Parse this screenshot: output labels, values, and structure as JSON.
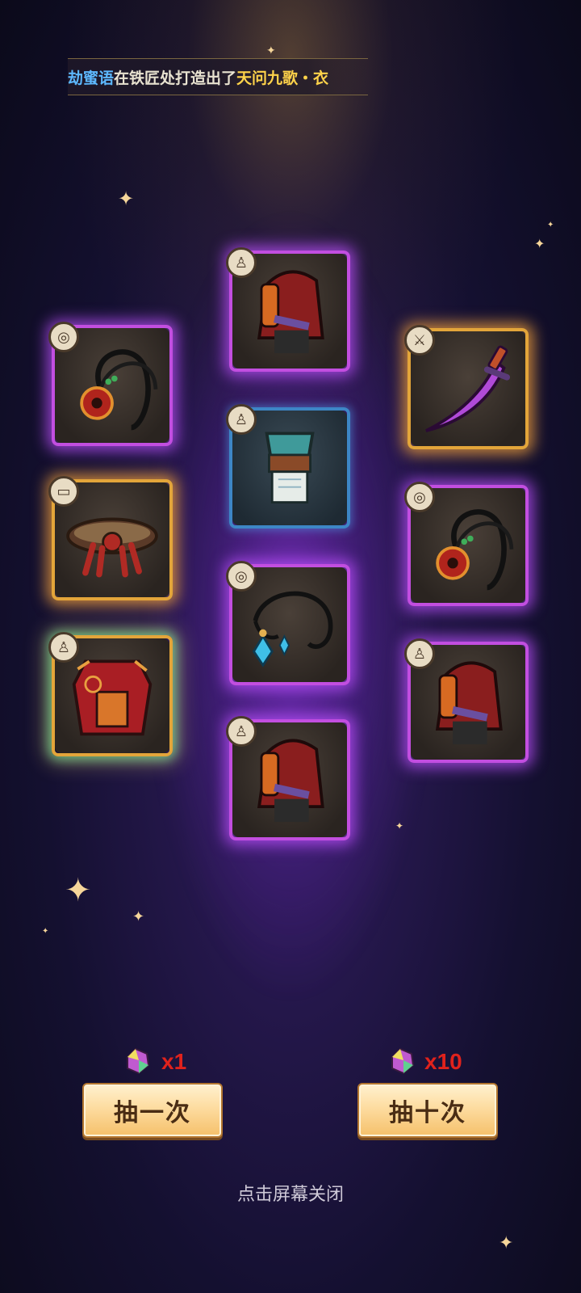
{
  "marquee": {
    "user": "劫蜜语",
    "middle": "在铁匠处打造出了",
    "item": "天问九歌・衣"
  },
  "slots": [
    {
      "id": "amulet-dragon-1",
      "quality": "purple",
      "badge_icon": "necklace-icon",
      "item_icon": "dragon-pendant-necklace-icon"
    },
    {
      "id": "belt-tassel",
      "quality": "gold",
      "badge_icon": "belt-icon",
      "item_icon": "tasseled-belt-icon"
    },
    {
      "id": "robe-red",
      "quality": "rainbow",
      "badge_icon": "armor-icon",
      "item_icon": "red-robe-armor-icon"
    },
    {
      "id": "hood-armor-1",
      "quality": "purple",
      "badge_icon": "armor-icon",
      "item_icon": "hooded-armor-icon"
    },
    {
      "id": "vest-teal",
      "quality": "blue",
      "badge_icon": "armor-icon",
      "item_icon": "teal-vest-icon"
    },
    {
      "id": "amulet-crystal",
      "quality": "purple",
      "badge_icon": "necklace-icon",
      "item_icon": "crystal-necklace-icon"
    },
    {
      "id": "hood-armor-2",
      "quality": "purple",
      "badge_icon": "armor-icon",
      "item_icon": "hooded-armor-icon"
    },
    {
      "id": "sword-purple",
      "quality": "gold",
      "badge_icon": "weapon-icon",
      "item_icon": "purple-sabre-icon"
    },
    {
      "id": "amulet-dragon-2",
      "quality": "purple",
      "badge_icon": "necklace-icon",
      "item_icon": "dragon-pendant-necklace-icon"
    },
    {
      "id": "hood-armor-3",
      "quality": "purple",
      "badge_icon": "armor-icon",
      "item_icon": "hooded-armor-icon"
    }
  ],
  "draw_once": {
    "cost": "x1",
    "label": "抽一次",
    "currency_icon": "crystal-gem-icon"
  },
  "draw_ten": {
    "cost": "x10",
    "label": "抽十次",
    "currency_icon": "crystal-gem-icon"
  },
  "close_hint": "点击屏幕关闭",
  "colors": {
    "purple_frame": "#c24ee0",
    "gold_frame": "#e3a53a",
    "blue_frame": "#3d86c6",
    "cost_red": "#e0221c",
    "button_fill": "#fddca0"
  }
}
